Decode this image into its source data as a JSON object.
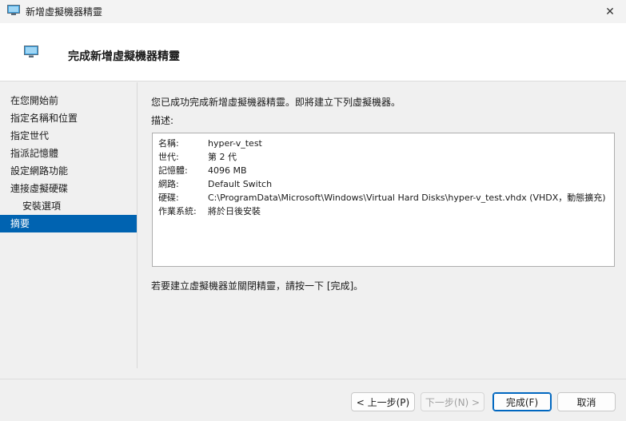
{
  "window": {
    "title": "新增虛擬機器精靈",
    "close_glyph": "✕"
  },
  "header": {
    "title": "完成新增虛擬機器精靈"
  },
  "sidebar": {
    "items": [
      {
        "label": "在您開始前"
      },
      {
        "label": "指定名稱和位置"
      },
      {
        "label": "指定世代"
      },
      {
        "label": "指派記憶體"
      },
      {
        "label": "設定網路功能"
      },
      {
        "label": "連接虛擬硬碟"
      },
      {
        "label": "安裝選項"
      },
      {
        "label": "摘要"
      }
    ]
  },
  "content": {
    "intro": "您已成功完成新增虛擬機器精靈。即將建立下列虛擬機器。",
    "desc_label": "描述:",
    "summary": [
      {
        "key": "名稱:",
        "value": "hyper-v_test"
      },
      {
        "key": "世代:",
        "value": "第 2 代"
      },
      {
        "key": "記憶體:",
        "value": "4096 MB"
      },
      {
        "key": "網路:",
        "value": "Default Switch"
      },
      {
        "key": "硬碟:",
        "value": "C:\\ProgramData\\Microsoft\\Windows\\Virtual Hard Disks\\hyper-v_test.vhdx (VHDX，動態擴充)"
      },
      {
        "key": "作業系統:",
        "value": "將於日後安裝"
      }
    ],
    "footer": "若要建立虛擬機器並關閉精靈，請按一下 [完成]。"
  },
  "buttons": {
    "back": "< 上一步(P)",
    "next": "下一步(N) >",
    "finish": "完成(F)",
    "cancel": "取消"
  },
  "colors": {
    "accent": "#0063b1",
    "primary_border": "#0067c0"
  }
}
